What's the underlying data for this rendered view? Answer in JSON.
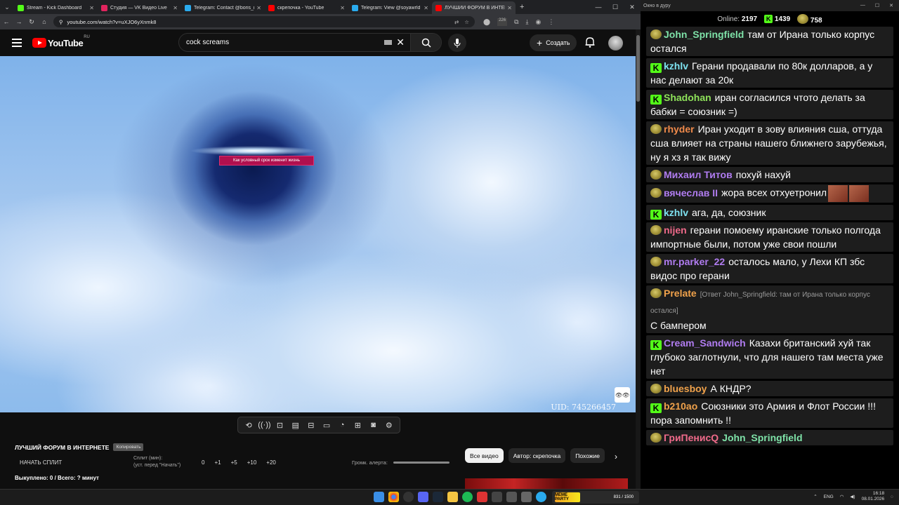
{
  "browser": {
    "tabs": [
      {
        "title": "Stream - Kick Dashboard",
        "color": "#53fc18"
      },
      {
        "title": "Студия — VK Видео Live",
        "color": "#e0245e"
      },
      {
        "title": "Telegram: Contact @boris_roch",
        "color": "#2aabee"
      },
      {
        "title": "скрепочка - YouTube",
        "color": "#ff0000"
      },
      {
        "title": "Telegram: View @soyawrld",
        "color": "#2aabee"
      },
      {
        "title": "ЛУЧШИЙ ФОРУМ В ИНТЕРНЕ",
        "color": "#ff0000"
      }
    ],
    "url": "youtube.com/watch?v=uXJO6yXnmk8",
    "ext_badge": "226"
  },
  "youtube": {
    "logo": "YouTube",
    "region": "RU",
    "search_query": "cock screams",
    "create_label": "Создать",
    "video_caption": "Как условный срок изменит жизнь",
    "uid": "UID: 745266457",
    "watermark": "👁👁",
    "video_title": "ЛУЧШИЙ ФОРУМ В ИНТЕРНЕТЕ",
    "copy_label": "Копировать",
    "start_split": "НАЧАТЬ СПЛИТ",
    "split_label": "Сплит (мин):",
    "split_hint": "(уст. перед \"Начать\")",
    "split_values": [
      "0",
      "+1",
      "+5",
      "+10",
      "+20"
    ],
    "alert_volume": "Громк. алерта:",
    "sold": "Выкуплено: 0 / Всего: ? минут",
    "chips": [
      "Все видео",
      "Автор: скрепочка",
      "Похожие"
    ]
  },
  "tools": [
    "⟲",
    "((·))",
    "⊡",
    "▤",
    "⊟",
    "▭",
    "◔",
    "⊞",
    "◙",
    "⚙"
  ],
  "chat": {
    "window_title": "Окно в дуру",
    "online_label": "Online:",
    "online_count": "2197",
    "kick_count": "1439",
    "other_count": "758",
    "messages": [
      {
        "badge": "p",
        "user": "John_Springfield",
        "color": "#7ee2a8",
        "text": "там от Ирана только корпус остался"
      },
      {
        "badge": "k",
        "user": "kzhlv",
        "color": "#7ee2f0",
        "text": "Герани продавали по 80к долларов, а у нас делают за 20к"
      },
      {
        "badge": "k",
        "user": "Shadohan",
        "color": "#8ee25a",
        "text": "иран согласился чтото делать за бабки = союзник =)"
      },
      {
        "badge": "p",
        "user": "rhyder",
        "color": "#f08a4b",
        "text": "Иран уходит в зову влияния сша, оттуда сша влияет на страны нашего ближнего зарубежья, ну я хз я так вижу"
      },
      {
        "badge": "p",
        "user": "Михаил Титов",
        "color": "#b07cf0",
        "text": "похуй нахуй"
      },
      {
        "badge": "p",
        "user": "вячеслав II",
        "color": "#b07cf0",
        "text": "жора всех отхуетронил"
      },
      {
        "badge": "k",
        "user": "kzhlv",
        "color": "#7ee2f0",
        "text": "ага, да, союзник"
      },
      {
        "badge": "p",
        "user": "nijen",
        "color": "#f06a8a",
        "text": "герани помоему иранские только полгода импортные были, потом уже свои пошли"
      },
      {
        "badge": "p",
        "user": "mr.parker_22",
        "color": "#b07cf0",
        "text": "осталось мало, у Лехи КП збс видос про герани"
      },
      {
        "badge": "p",
        "user": "Prelate",
        "color": "#f0a24b",
        "reply": "[Ответ John_Springfield: там от Ирана только корпус остался]",
        "text": "С бампером"
      },
      {
        "badge": "k",
        "user": "Cream_Sandwich",
        "color": "#b07cf0",
        "text": "Казахи британский хуй так глубоко заглотнули, что для нашего там места уже нет"
      },
      {
        "badge": "p",
        "user": "bluesboy",
        "color": "#f0a24b",
        "text": "А КНДР?"
      },
      {
        "badge": "k",
        "user": "b210ao",
        "color": "#f0a24b",
        "text": "Союзники это Армия и Флот России !!! пора запомнить !!"
      },
      {
        "badge": "p",
        "user": "ГриПенисQ",
        "color": "#f06a8a",
        "text": "John_Springfield",
        "text_color": "#7ee2a8"
      }
    ]
  },
  "taskbar": {
    "widget_label": "MEME PARTY",
    "widget_progress": "831 / 1500",
    "lang": "ENG",
    "time": "16:18",
    "date": "08.01.2026"
  }
}
